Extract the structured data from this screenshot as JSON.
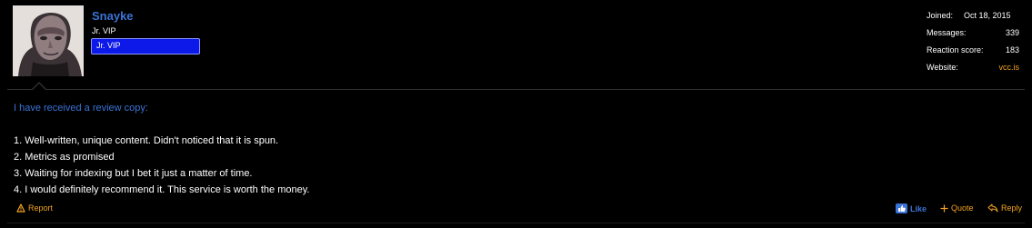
{
  "user": {
    "name": "Snayke",
    "title": "Jr. VIP",
    "banner": "Jr. VIP"
  },
  "stats": {
    "joined_label": "Joined:",
    "joined_value": "Oct 18, 2015",
    "messages_label": "Messages:",
    "messages_value": "339",
    "reaction_label": "Reaction score:",
    "reaction_value": "183",
    "website_label": "Website:",
    "website_value": "vcc.is"
  },
  "post": {
    "intro": "I have received a review copy:",
    "lines": [
      "1. Well-written, unique content. Didn't noticed that it is spun.",
      "2. Metrics as promised",
      "3. Waiting for indexing but I bet it just a matter of time.",
      "4. I would definitely recommend it. This service is worth the money."
    ]
  },
  "actions": {
    "report": "Report",
    "like": "Like",
    "quote": "Quote",
    "reply": "Reply"
  },
  "colors": {
    "background": "#000000",
    "link_blue": "#3b73d6",
    "accent_orange": "#f2a31f",
    "banner_blue": "#0c19e8"
  },
  "icons": {
    "report": "warning-icon",
    "like": "thumbs-up-icon",
    "quote": "plus-icon",
    "reply": "reply-arrow-icon"
  }
}
